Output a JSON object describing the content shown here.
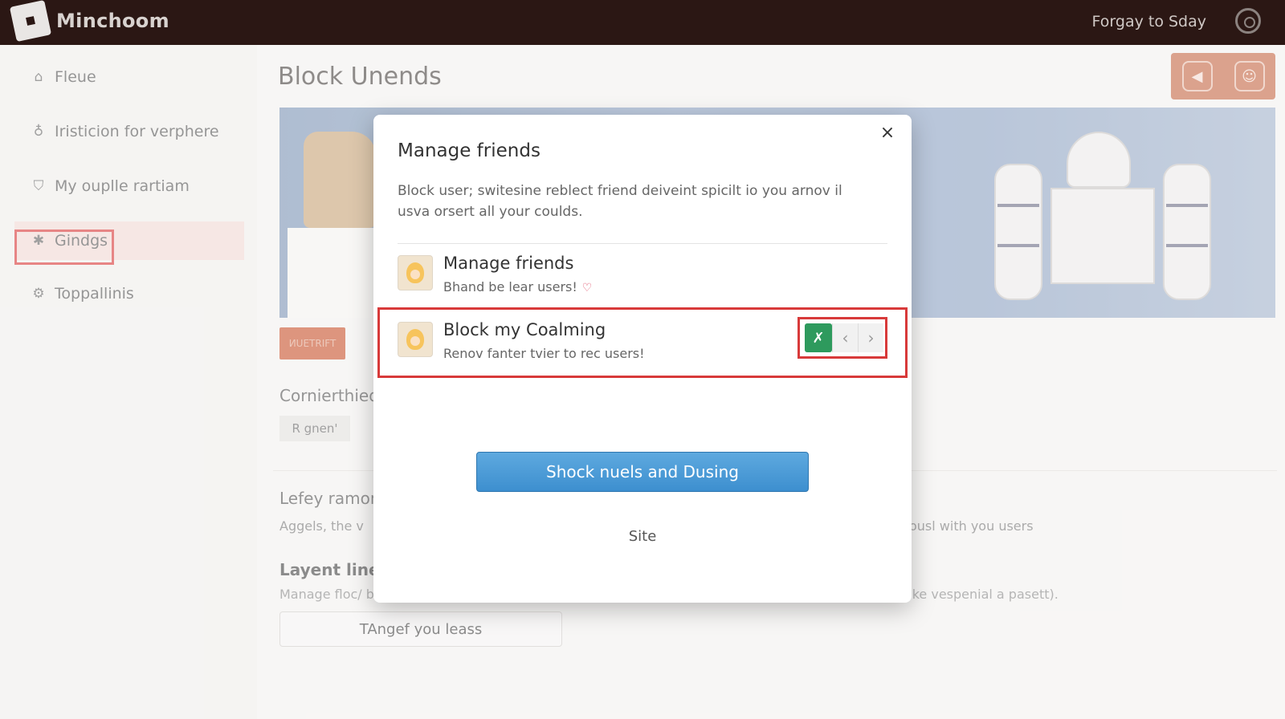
{
  "topbar": {
    "app_title": "Minchoom",
    "account_name": "Forgay to Sday",
    "logo_icon": "app-logo",
    "account_icon": "settings-ring-icon"
  },
  "sidebar": {
    "items": [
      {
        "label": "Fleue",
        "icon": "home-icon",
        "glyph": "⌂"
      },
      {
        "label": "Iristicion for verphere",
        "icon": "figure-icon",
        "glyph": "♁"
      },
      {
        "label": "My ouplle rartiam",
        "icon": "shield-icon",
        "glyph": "⛉"
      },
      {
        "label": "Gindgs",
        "icon": "puzzle-icon",
        "glyph": "✱",
        "active": true
      },
      {
        "label": "Toppallinis",
        "icon": "gear-icon",
        "glyph": "⚙"
      }
    ]
  },
  "main": {
    "page_title": "Block Unends",
    "header_icons": [
      "back-icon",
      "user-icon"
    ],
    "orange_button": "ИUETRIFT",
    "section_label": "Cornierthied",
    "chip": "R gnen'",
    "lefey": "Lefey ramon",
    "aggels": "Aggels, the v",
    "aggels_right": "ousl with you users",
    "layent": "Layent line",
    "manage_line": "Manage floc/ bloe canding a menhde is where you you poviny any tan the enly. you age eaouns (like vespenial a pasett).",
    "tangef_button": "TAngef you leass"
  },
  "modal": {
    "title": "Manage friends",
    "description": "Block user; switesine reblect friend deiveint spicilt io you arnov il usva orsert all your coulds.",
    "rows": [
      {
        "title": "Manage friends",
        "subtitle": "Bhand be lear users!",
        "heart": "♡"
      },
      {
        "title": "Block my Coalming",
        "subtitle": "Renov fanter tvier to rec users!"
      }
    ],
    "controls": {
      "action_icon": "block-user-icon",
      "action_glyph": "✗",
      "prev": "‹",
      "next": "›"
    },
    "primary_button": "Shock nuels and Dusing",
    "site_link": "Site",
    "close": "×"
  },
  "colors": {
    "topbar": "#2b1714",
    "accent_orange": "#c8552f",
    "primary_blue": "#3d8fcf",
    "highlight_red": "#d83a3a",
    "control_green": "#2e9a5d"
  }
}
